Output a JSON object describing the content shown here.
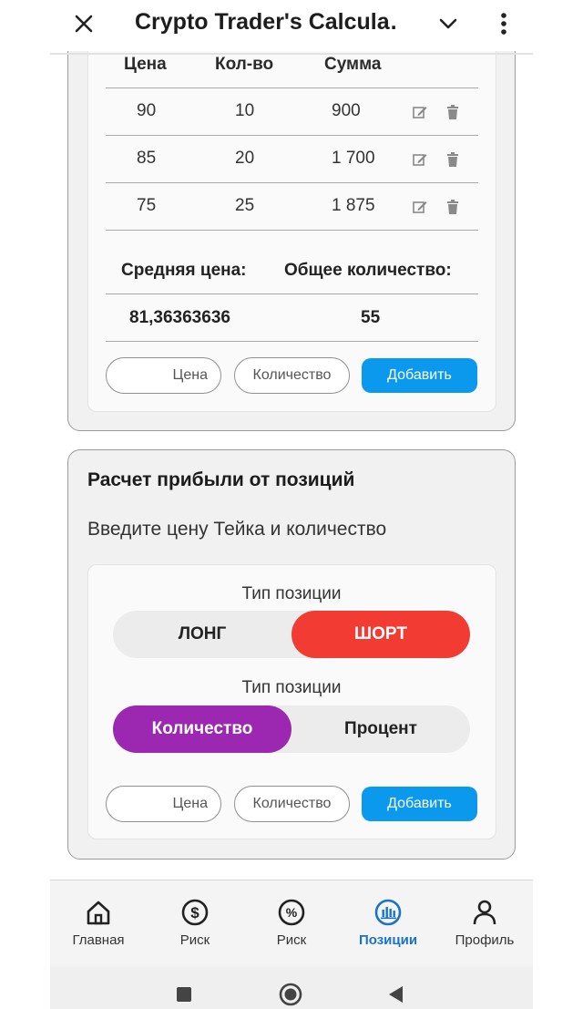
{
  "app": {
    "title": "Crypto Trader's Calcula…"
  },
  "table": {
    "headers": [
      "Цена",
      "Кол-во",
      "Сумма"
    ],
    "rows": [
      {
        "price": "90",
        "qty": "10",
        "sum": "900"
      },
      {
        "price": "85",
        "qty": "20",
        "sum": "1 700"
      },
      {
        "price": "75",
        "qty": "25",
        "sum": "1 875"
      }
    ]
  },
  "summary": {
    "avg_label": "Средняя цена:",
    "total_label": "Общее количество:",
    "avg_value": "81,36363636",
    "total_value": "55"
  },
  "inputs1": {
    "price_placeholder": "Цена",
    "qty_placeholder": "Количество",
    "add_label": "Добавить"
  },
  "profit": {
    "title": "Расчет прибыли от позиций",
    "subtitle": "Введите цену Тейка и количество",
    "type_label_1": "Тип позиции",
    "long_label": "ЛОНГ",
    "short_label": "ШОРТ",
    "type_label_2": "Тип позиции",
    "qty_option": "Количество",
    "pct_option": "Процент",
    "selected_side": "ШОРТ",
    "selected_mode": "Количество"
  },
  "inputs2": {
    "price_placeholder": "Цена",
    "qty_placeholder": "Количество",
    "add_label": "Добавить"
  },
  "nav": [
    {
      "label": "Главная",
      "icon": "home-icon"
    },
    {
      "label": "Риск",
      "icon": "dollar-circle-icon"
    },
    {
      "label": "Риск",
      "icon": "percent-circle-icon"
    },
    {
      "label": "Позиции",
      "icon": "chart-circle-icon",
      "active": true
    },
    {
      "label": "Профиль",
      "icon": "person-icon"
    }
  ],
  "colors": {
    "accent_blue": "#0b99ee",
    "short_red": "#f23b33",
    "qty_purple": "#9c27b0",
    "nav_active": "#1a73c7"
  }
}
